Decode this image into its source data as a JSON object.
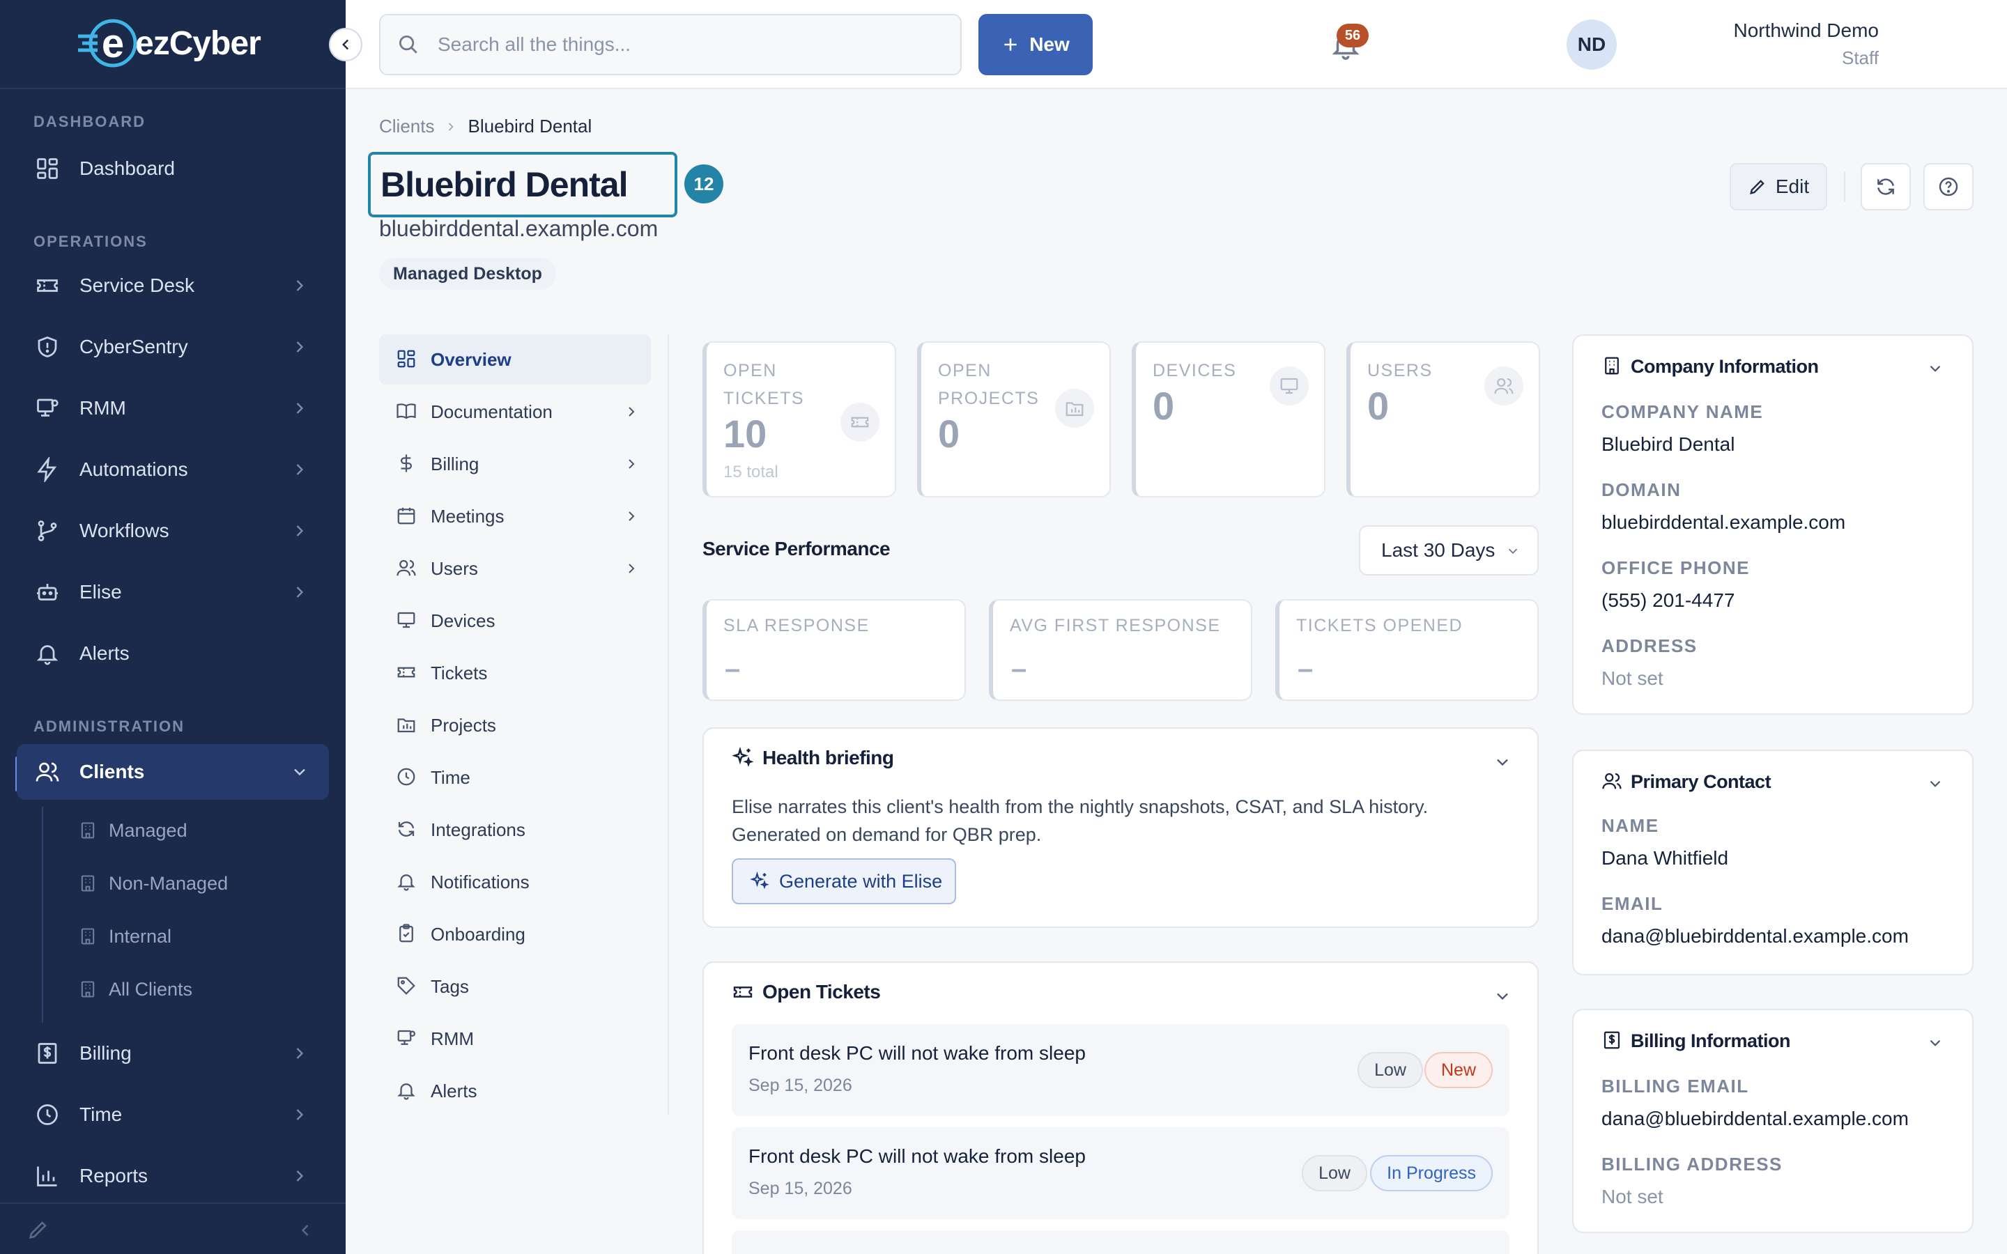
{
  "app": {
    "brand": "ezCyber",
    "brand_prefix": "e"
  },
  "sidebar": {
    "sections": {
      "dashboard": "DASHBOARD",
      "operations": "OPERATIONS",
      "administration": "ADMINISTRATION"
    },
    "items": {
      "dashboard": "Dashboard",
      "service_desk": "Service Desk",
      "cybersentry": "CyberSentry",
      "rmm": "RMM",
      "automations": "Automations",
      "workflows": "Workflows",
      "elise": "Elise",
      "alerts": "Alerts",
      "clients": "Clients",
      "billing": "Billing",
      "time": "Time",
      "reports": "Reports"
    },
    "client_subitems": [
      "Managed",
      "Non-Managed",
      "Internal",
      "All Clients"
    ]
  },
  "topbar": {
    "search_placeholder": "Search all the things...",
    "new_label": "New",
    "notification_count": "56",
    "user_name": "Northwind Demo",
    "user_role": "Staff",
    "user_initials": "ND"
  },
  "breadcrumb": {
    "parent": "Clients",
    "current": "Bluebird Dental"
  },
  "client": {
    "name": "Bluebird Dental",
    "count_badge": "12",
    "domain": "bluebirddental.example.com",
    "tag": "Managed Desktop"
  },
  "actions": {
    "edit_label": "Edit"
  },
  "subnav": [
    "Overview",
    "Documentation",
    "Billing",
    "Meetings",
    "Users",
    "Devices",
    "Tickets",
    "Projects",
    "Time",
    "Integrations",
    "Notifications",
    "Onboarding",
    "Tags",
    "RMM",
    "Alerts"
  ],
  "stats": {
    "open_tickets": {
      "label": "OPEN TICKETS",
      "value": "10",
      "sub": "15 total"
    },
    "open_projects": {
      "label": "OPEN PROJECTS",
      "value": "0"
    },
    "devices": {
      "label": "DEVICES",
      "value": "0"
    },
    "users": {
      "label": "USERS",
      "value": "0"
    }
  },
  "performance": {
    "title": "Service Performance",
    "range": "Last 30 Days",
    "sla": {
      "label": "SLA RESPONSE",
      "value": "–"
    },
    "avg_first": {
      "label": "AVG FIRST RESPONSE",
      "value": "–"
    },
    "opened": {
      "label": "TICKETS OPENED",
      "value": "–"
    }
  },
  "briefing": {
    "title": "Health briefing",
    "text": "Elise narrates this client's health from the nightly snapshots, CSAT, and SLA history. Generated on demand for QBR prep.",
    "button": "Generate with Elise"
  },
  "open_tickets": {
    "title": "Open Tickets",
    "items": [
      {
        "title": "Front desk PC will not wake from sleep",
        "date": "Sep 15, 2026",
        "priority": "Low",
        "status": "New"
      },
      {
        "title": "Front desk PC will not wake from sleep",
        "date": "Sep 15, 2026",
        "priority": "Low",
        "status": "In Progress"
      }
    ]
  },
  "company": {
    "title": "Company Information",
    "name_label": "COMPANY NAME",
    "name": "Bluebird Dental",
    "domain_label": "DOMAIN",
    "domain": "bluebirddental.example.com",
    "phone_label": "OFFICE PHONE",
    "phone": "(555) 201-4477",
    "address_label": "ADDRESS",
    "address": "Not set"
  },
  "contact": {
    "title": "Primary Contact",
    "name_label": "NAME",
    "name": "Dana Whitfield",
    "email_label": "EMAIL",
    "email": "dana@bluebirddental.example.com"
  },
  "billing": {
    "title": "Billing Information",
    "email_label": "BILLING EMAIL",
    "email": "dana@bluebirddental.example.com",
    "address_label": "BILLING ADDRESS",
    "address": "Not set"
  },
  "colors": {
    "sidebar": "#1b2a4a",
    "accent": "#3a62b5",
    "highlight": "#2384a8",
    "danger": "#c0391b"
  }
}
